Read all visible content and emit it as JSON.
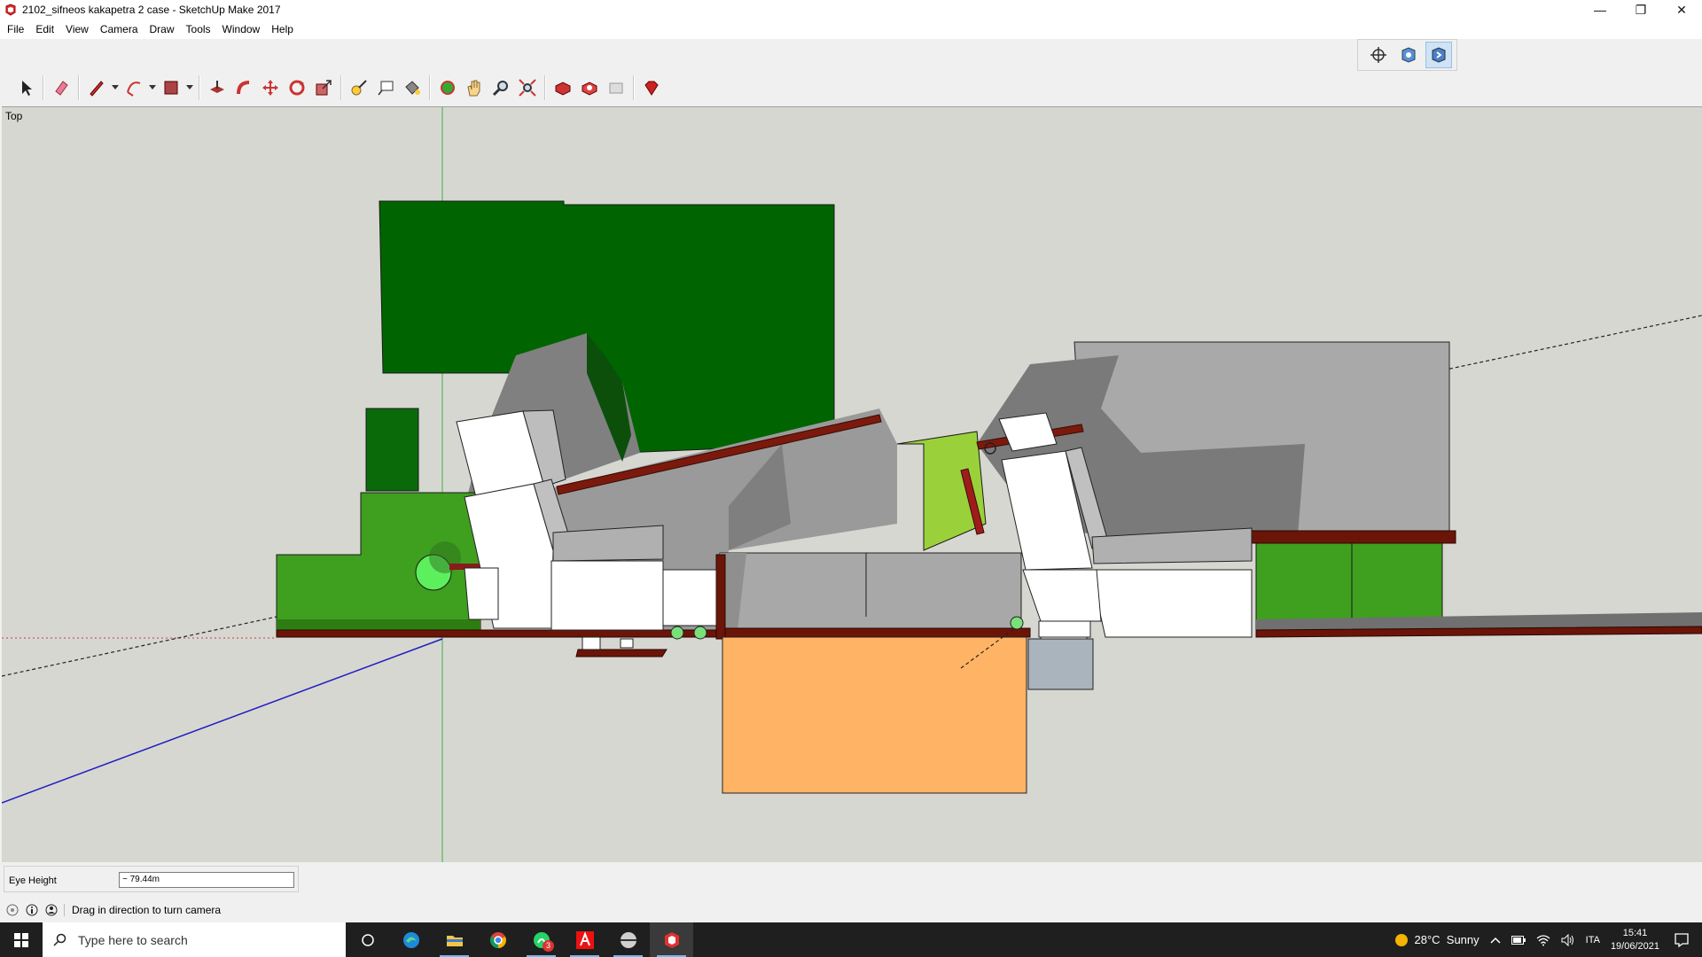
{
  "window": {
    "title": "2102_sifneos kakapetra 2 case - SketchUp Make 2017",
    "controls": {
      "minimize": "—",
      "maximize": "❐",
      "close": "✕"
    }
  },
  "menu": [
    "File",
    "Edit",
    "View",
    "Camera",
    "Draw",
    "Tools",
    "Window",
    "Help"
  ],
  "toolbar": {
    "tools": [
      "select-icon",
      "eraser-icon",
      "line-pencil-icon",
      "arc-icon",
      "rectangle-icon",
      "push-pull-icon",
      "follow-me-icon",
      "move-icon",
      "rotate-icon",
      "scale-icon",
      "tape-measure-icon",
      "text-icon",
      "paint-bucket-icon",
      "orbit-icon",
      "pan-icon",
      "zoom-icon",
      "zoom-extents-icon",
      "3d-warehouse-icon",
      "extension-warehouse-icon",
      "layout-icon",
      "ruby-console-icon"
    ],
    "views": [
      "look-around-icon",
      "position-camera-icon",
      "walk-icon"
    ],
    "active_view_tool": "walk-icon"
  },
  "viewport": {
    "view_label": "Top",
    "colors": {
      "background": "#d7d7d2",
      "green_axis": "#4caf50",
      "blue_axis": "#2020c0",
      "red_axis": "#c04040"
    }
  },
  "vcb": {
    "label": "Eye Height",
    "value": "~ 79.44m"
  },
  "status": {
    "text": "Drag in direction to turn camera"
  },
  "taskbar": {
    "search_placeholder": "Type here to search",
    "apps": [
      "task-view-icon",
      "edge-icon",
      "file-explorer-icon",
      "chrome-icon",
      "whatsapp-icon",
      "autocad-icon",
      "app-icon",
      "sketchup-icon"
    ],
    "whatsapp_badge": "3",
    "weather": "28°C  Sunny",
    "language": "ITA",
    "time": "15:41",
    "date": "19/06/2021"
  }
}
